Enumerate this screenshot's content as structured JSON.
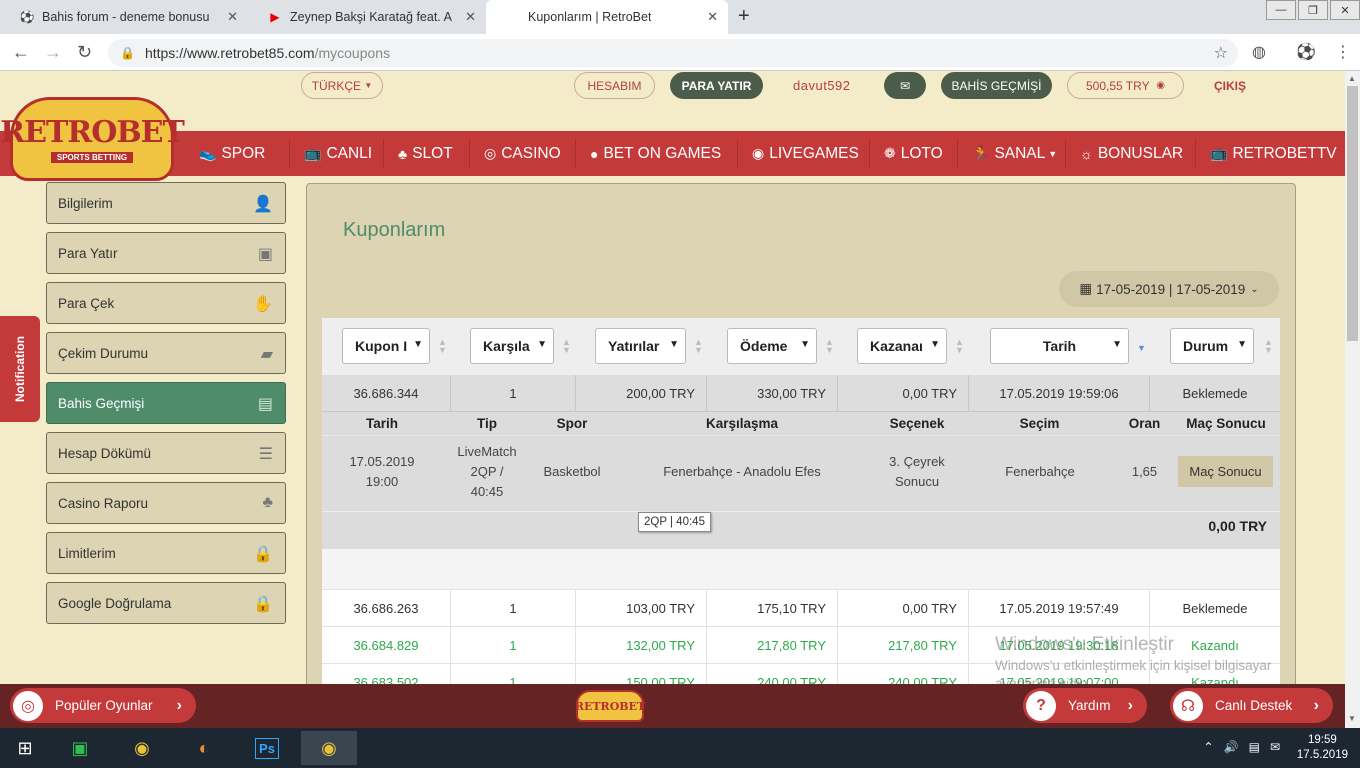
{
  "browser": {
    "tabs": [
      {
        "title": "Bahis forum - deneme bonusu | b",
        "icon": "soccer-ball-icon"
      },
      {
        "title": "Zeynep Bakşi Karatağ feat. A",
        "icon": "youtube-icon"
      },
      {
        "title": "Kuponlarım | RetroBet",
        "icon": "loading-icon"
      }
    ],
    "new_tab": "+",
    "url_main": "https://www.retrobet85.com",
    "url_path": "/mycoupons"
  },
  "topbar": {
    "language": "TÜRKÇE",
    "account": "HESABIM",
    "deposit": "PARA YATIR",
    "username": "davut592",
    "history": "BAHİS GEÇMİŞİ",
    "balance": "500,55 TRY",
    "logout": "ÇIKIŞ"
  },
  "logo": {
    "title": "RETROBET",
    "subtitle": "SPORTS BETTING",
    "small": "RETROBET"
  },
  "nav": [
    "SPOR",
    "CANLI",
    "SLOT",
    "CASINO",
    "BET ON GAMES",
    "LIVEGAMES",
    "LOTO",
    "SANAL",
    "BONUSLAR",
    "RETROBETTV"
  ],
  "sidebar": [
    "Bilgilerim",
    "Para Yatır",
    "Para Çek",
    "Çekim Durumu",
    "Bahis Geçmişi",
    "Hesap Dökümü",
    "Casino Raporu",
    "Limitlerim",
    "Google Doğrulama"
  ],
  "notification": "Notification",
  "page": {
    "title": "Kuponlarım",
    "date_range": "17-05-2019 | 17-05-2019"
  },
  "filters": [
    "Kupon I",
    "Karşıla",
    "Yatırılar",
    "Ödeme",
    "Kazanaı",
    "Tarih",
    "Durum"
  ],
  "rows": [
    {
      "id": "36.686.344",
      "count": "1",
      "stake": "200,00 TRY",
      "payout": "330,00 TRY",
      "won": "0,00 TRY",
      "date": "17.05.2019 19:59:06",
      "status": "Beklemede"
    },
    {
      "id": "36.686.263",
      "count": "1",
      "stake": "103,00 TRY",
      "payout": "175,10 TRY",
      "won": "0,00 TRY",
      "date": "17.05.2019 19:57:49",
      "status": "Beklemede"
    },
    {
      "id": "36.684.829",
      "count": "1",
      "stake": "132,00 TRY",
      "payout": "217,80 TRY",
      "won": "217,80 TRY",
      "date": "17.05.2019 19:30:18",
      "status": "Kazandı"
    },
    {
      "id": "36.683.502",
      "count": "1",
      "stake": "150,00 TRY",
      "payout": "240,00 TRY",
      "won": "240,00 TRY",
      "date": "17.05.2019 19:07:00",
      "status": "Kazandı"
    }
  ],
  "detail": {
    "headers": [
      "Tarih",
      "Tip",
      "Spor",
      "Karşılaşma",
      "Seçenek",
      "Seçim",
      "Oran",
      "Maç Sonucu"
    ],
    "date_line1": "17.05.2019",
    "date_line2": "19:00",
    "type_line1": "LiveMatch",
    "type_line2": "2QP /",
    "type_line3": "40:45",
    "sport": "Basketbol",
    "match": "Fenerbahçe - Anadolu Efes",
    "option_line1": "3. Çeyrek",
    "option_line2": "Sonucu",
    "selection": "Fenerbahçe",
    "odds": "1,65",
    "result_button": "Maç Sonucu",
    "total": "0,00 TRY",
    "tooltip": "2QP | 40:45"
  },
  "watermark": {
    "title": "Windows'u Etkinleştir",
    "text": "Windows'u etkinleştirmek için kişisel bilgisayar ayarlarına gidin."
  },
  "bottombar": {
    "popular": "Popüler Oyunlar",
    "help": "Yardım",
    "support": "Canlı Destek"
  },
  "taskbar": {
    "time": "19:59",
    "date": "17.5.2019",
    "ps_label": "Ps"
  }
}
